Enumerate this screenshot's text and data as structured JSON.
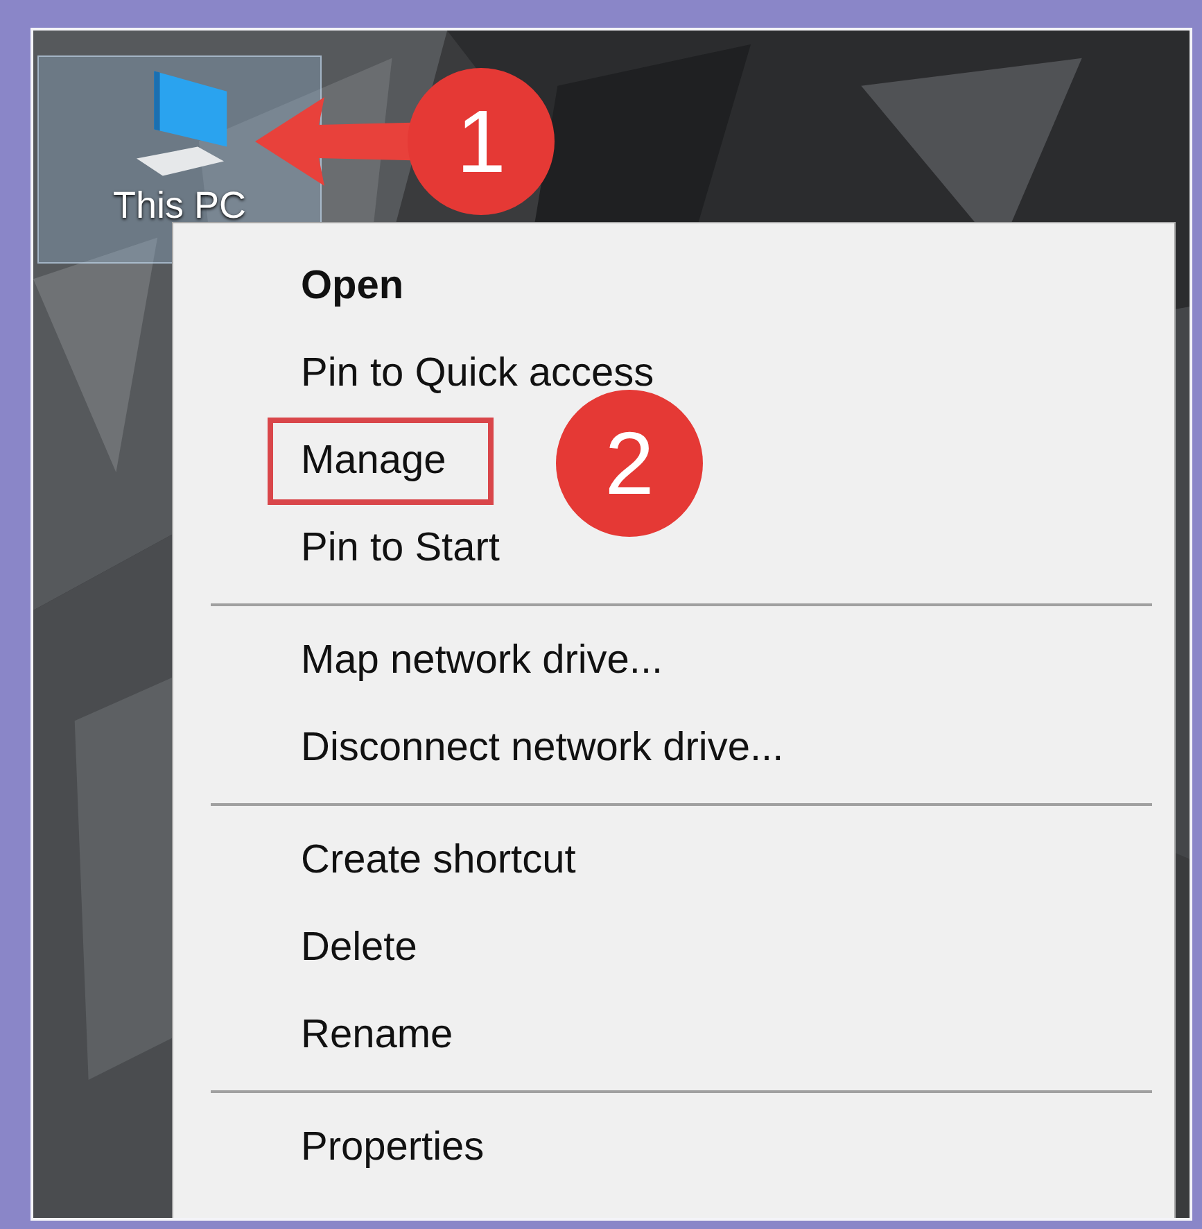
{
  "desktop": {
    "icon": {
      "label": "This PC",
      "selected": true,
      "step": "1"
    }
  },
  "context_menu": {
    "items": [
      {
        "kind": "item",
        "label": "Open",
        "default": true
      },
      {
        "kind": "item",
        "label": "Pin to Quick access",
        "default": false
      },
      {
        "kind": "item",
        "label": "Manage",
        "default": false,
        "marked": true,
        "step": "2"
      },
      {
        "kind": "item",
        "label": "Pin to Start",
        "default": false
      },
      {
        "kind": "separator"
      },
      {
        "kind": "item",
        "label": "Map network drive...",
        "default": false
      },
      {
        "kind": "item",
        "label": "Disconnect network drive...",
        "default": false
      },
      {
        "kind": "separator"
      },
      {
        "kind": "item",
        "label": "Create shortcut",
        "default": false
      },
      {
        "kind": "item",
        "label": "Delete",
        "default": false
      },
      {
        "kind": "item",
        "label": "Rename",
        "default": false
      },
      {
        "kind": "separator"
      },
      {
        "kind": "item",
        "label": "Properties",
        "default": false
      }
    ]
  }
}
